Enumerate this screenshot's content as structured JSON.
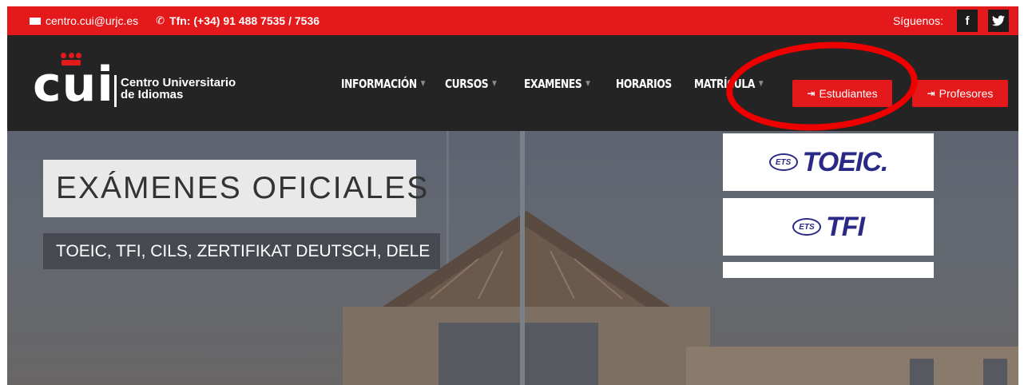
{
  "topbar": {
    "email": "centro.cui@urjc.es",
    "phone": "Tfn: (+34) 91 488 7535 / 7536",
    "follow_label": "Síguenos:",
    "social": [
      {
        "label": "f",
        "icon": "facebook-icon"
      },
      {
        "label": "y",
        "icon": "twitter-icon"
      }
    ]
  },
  "logo": {
    "letters": "CUI",
    "line1": "Centro Universitario",
    "line2": "de Idiomas"
  },
  "nav": {
    "items": [
      {
        "label": "INFORMACIÓN",
        "dropdown": true
      },
      {
        "label": "CURSOS",
        "dropdown": true
      },
      {
        "label": "EXAMENES",
        "dropdown": true
      },
      {
        "label": "HORARIOS",
        "dropdown": false
      },
      {
        "label": "MATRÍCULA",
        "dropdown": true
      }
    ],
    "caret": "▼",
    "students_button": "Estudiantes",
    "teachers_button": "Profesores"
  },
  "hero": {
    "title": "EXÁMENES OFICIALES",
    "subtitle": "TOEIC, TFI, CILS, ZERTIFIKAT DEUTSCH, DELE"
  },
  "exams": [
    {
      "badge": "ETS",
      "name": "TOEIC."
    },
    {
      "badge": "ETS",
      "name": "TFI"
    }
  ],
  "colors": {
    "brand_red": "#e3191b",
    "nav_dark": "#242424",
    "exam_blue": "#2a2a86",
    "annotation_red": "#ee0000"
  }
}
